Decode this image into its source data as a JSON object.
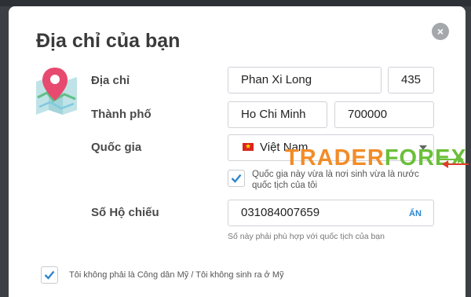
{
  "modal": {
    "title": "Địa chỉ của bạn",
    "close_label": "×"
  },
  "form": {
    "address": {
      "label": "Địa chỉ",
      "street": "Phan Xi Long",
      "number": "435"
    },
    "city": {
      "label": "Thành phố",
      "name": "Ho Chi Minh",
      "postal_code": "700000"
    },
    "country": {
      "label": "Quốc gia",
      "selected": "Việt Nam",
      "checkbox_label_line1": "Quốc gia này vừa là nơi sinh vừa là nước",
      "checkbox_label_line2": "quốc tịch của tôi",
      "checked": true
    },
    "passport": {
      "label": "Số Hộ chiếu",
      "value": "031084007659",
      "reveal_label": "ẨN",
      "hint": "Số này phải phù hợp với quốc tịch của bạn"
    },
    "us_citizen": {
      "label": "Tôi không phải là Công dân Mỹ / Tôi không sinh ra ở Mỹ",
      "checked": true
    }
  },
  "watermark": {
    "part1": "TRADER",
    "part2": "FOREX"
  },
  "colors": {
    "accent": "#2a86d1",
    "watermark_orange": "#f28c28",
    "watermark_green": "#6bbf3a"
  }
}
